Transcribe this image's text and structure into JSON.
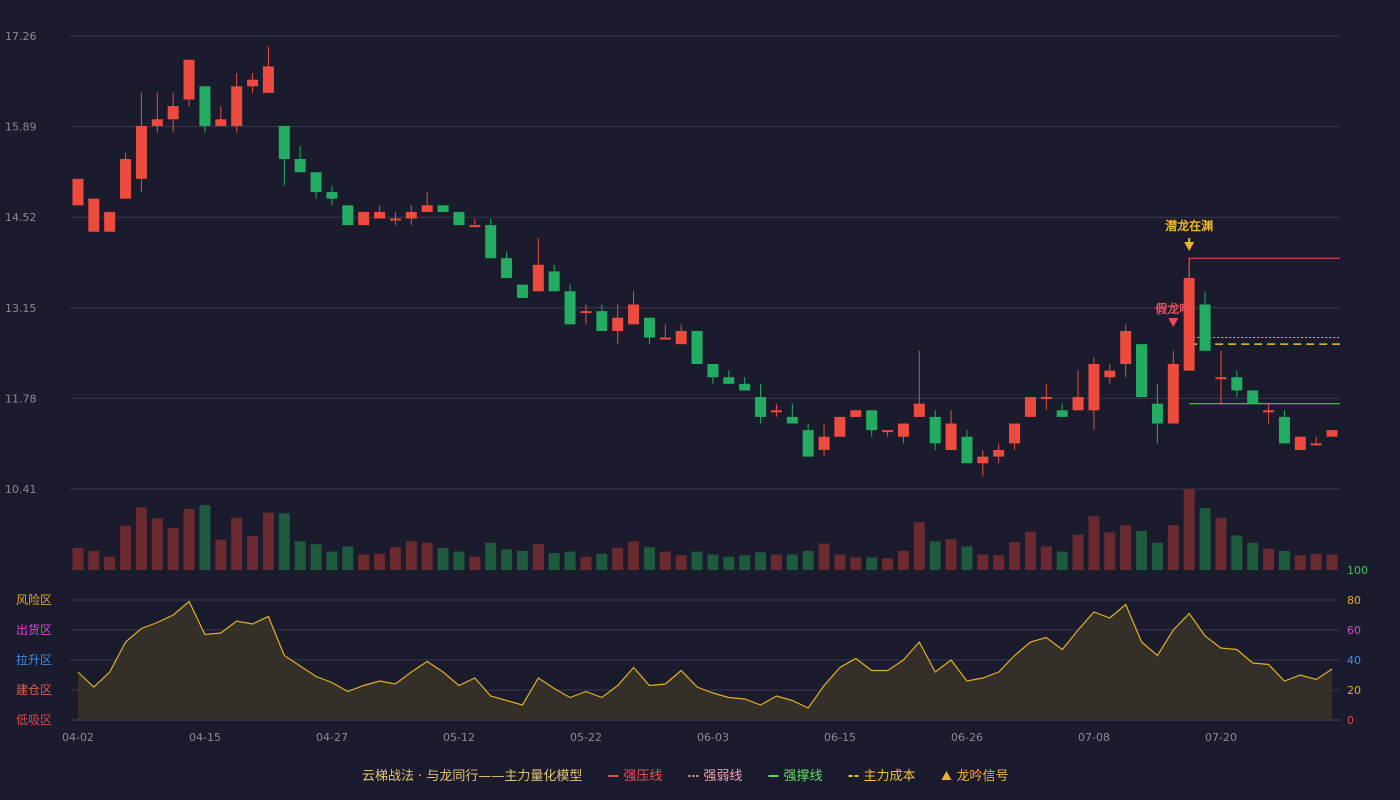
{
  "chart_data": {
    "type": "candlestick",
    "price_axis": {
      "ticks": [
        "17.26",
        "15.89",
        "14.52",
        "13.15",
        "11.78",
        "10.41"
      ],
      "ylim": [
        10.41,
        17.26
      ]
    },
    "date_ticks": [
      "04-02",
      "04-15",
      "04-27",
      "05-12",
      "05-22",
      "06-03",
      "06-15",
      "06-26",
      "07-08",
      "07-20"
    ],
    "candles": [
      [
        14.7,
        15.1,
        15.1,
        14.7
      ],
      [
        14.3,
        14.8,
        14.8,
        14.3
      ],
      [
        14.3,
        14.6,
        14.6,
        14.3
      ],
      [
        14.8,
        15.4,
        15.5,
        14.8
      ],
      [
        15.1,
        15.9,
        16.4,
        14.9
      ],
      [
        15.9,
        16.0,
        16.4,
        15.8
      ],
      [
        16.0,
        16.2,
        16.4,
        15.8
      ],
      [
        16.3,
        16.9,
        16.9,
        16.2
      ],
      [
        16.5,
        15.9,
        16.5,
        15.8
      ],
      [
        15.9,
        16.0,
        16.2,
        15.9
      ],
      [
        15.9,
        16.5,
        16.7,
        15.8
      ],
      [
        16.5,
        16.6,
        16.7,
        16.4
      ],
      [
        16.4,
        16.8,
        17.1,
        16.4
      ],
      [
        15.9,
        15.4,
        15.9,
        15.0
      ],
      [
        15.4,
        15.2,
        15.6,
        15.2
      ],
      [
        15.2,
        14.9,
        15.2,
        14.8
      ],
      [
        14.9,
        14.8,
        15.0,
        14.7
      ],
      [
        14.7,
        14.4,
        14.7,
        14.4
      ],
      [
        14.4,
        14.6,
        14.6,
        14.4
      ],
      [
        14.5,
        14.6,
        14.7,
        14.5
      ],
      [
        14.5,
        14.5,
        14.6,
        14.4
      ],
      [
        14.5,
        14.6,
        14.7,
        14.4
      ],
      [
        14.6,
        14.7,
        14.9,
        14.6
      ],
      [
        14.7,
        14.6,
        14.7,
        14.6
      ],
      [
        14.6,
        14.4,
        14.6,
        14.4
      ],
      [
        14.4,
        14.4,
        14.5,
        14.4
      ],
      [
        14.4,
        13.9,
        14.5,
        13.9
      ],
      [
        13.9,
        13.6,
        14.0,
        13.6
      ],
      [
        13.5,
        13.3,
        13.5,
        13.3
      ],
      [
        13.4,
        13.8,
        14.2,
        13.4
      ],
      [
        13.7,
        13.4,
        13.8,
        13.4
      ],
      [
        13.4,
        12.9,
        13.5,
        12.9
      ],
      [
        13.1,
        13.1,
        13.2,
        12.9
      ],
      [
        13.1,
        12.8,
        13.2,
        12.8
      ],
      [
        12.8,
        13.0,
        13.2,
        12.6
      ],
      [
        12.9,
        13.2,
        13.4,
        12.9
      ],
      [
        13.0,
        12.7,
        13.0,
        12.6
      ],
      [
        12.7,
        12.7,
        12.9,
        12.7
      ],
      [
        12.6,
        12.8,
        12.9,
        12.6
      ],
      [
        12.8,
        12.3,
        12.8,
        12.3
      ],
      [
        12.3,
        12.1,
        12.3,
        12.0
      ],
      [
        12.1,
        12.0,
        12.2,
        12.0
      ],
      [
        12.0,
        11.9,
        12.1,
        11.9
      ],
      [
        11.8,
        11.5,
        12.0,
        11.4
      ],
      [
        11.6,
        11.6,
        11.7,
        11.5
      ],
      [
        11.5,
        11.4,
        11.7,
        11.4
      ],
      [
        11.3,
        10.9,
        11.4,
        10.9
      ],
      [
        11.0,
        11.2,
        11.4,
        10.9
      ],
      [
        11.2,
        11.5,
        11.5,
        11.2
      ],
      [
        11.5,
        11.6,
        11.6,
        11.5
      ],
      [
        11.6,
        11.3,
        11.6,
        11.2
      ],
      [
        11.3,
        11.3,
        11.3,
        11.2
      ],
      [
        11.2,
        11.4,
        11.4,
        11.1
      ],
      [
        11.5,
        11.7,
        12.5,
        11.5
      ],
      [
        11.5,
        11.1,
        11.6,
        11.0
      ],
      [
        11.0,
        11.4,
        11.6,
        11.0
      ],
      [
        11.2,
        10.8,
        11.3,
        10.8
      ],
      [
        10.8,
        10.9,
        11.0,
        10.6
      ],
      [
        10.9,
        11.0,
        11.1,
        10.8
      ],
      [
        11.1,
        11.4,
        11.4,
        11.0
      ],
      [
        11.5,
        11.8,
        11.8,
        11.5
      ],
      [
        11.8,
        11.8,
        12.0,
        11.6
      ],
      [
        11.6,
        11.5,
        11.7,
        11.5
      ],
      [
        11.6,
        11.8,
        12.2,
        11.6
      ],
      [
        11.6,
        12.3,
        12.4,
        11.3
      ],
      [
        12.1,
        12.2,
        12.3,
        12.0
      ],
      [
        12.3,
        12.8,
        12.9,
        12.1
      ],
      [
        12.6,
        11.8,
        12.6,
        11.8
      ],
      [
        11.7,
        11.4,
        12.0,
        11.1
      ],
      [
        11.4,
        12.3,
        12.5,
        11.4
      ],
      [
        12.2,
        13.6,
        13.9,
        12.2
      ],
      [
        13.2,
        12.5,
        13.4,
        12.5
      ],
      [
        12.1,
        12.1,
        12.5,
        11.7
      ],
      [
        12.1,
        11.9,
        12.2,
        11.8
      ],
      [
        11.9,
        11.7,
        11.9,
        11.7
      ],
      [
        11.6,
        11.6,
        11.7,
        11.4
      ],
      [
        11.5,
        11.1,
        11.6,
        11.1
      ],
      [
        11.0,
        11.2,
        11.2,
        11.0
      ],
      [
        11.1,
        11.1,
        11.2,
        11.1
      ],
      [
        11.2,
        11.3,
        11.3,
        11.2
      ]
    ],
    "volume": [
      3,
      2.6,
      1.8,
      6,
      8.5,
      7,
      5.7,
      8.3,
      8.8,
      4.1,
      7.1,
      4.6,
      7.8,
      7.7,
      3.9,
      3.5,
      2.5,
      3.2,
      2.1,
      2.2,
      3.1,
      3.9,
      3.7,
      3.0,
      2.5,
      1.8,
      3.7,
      2.8,
      2.6,
      3.5,
      2.3,
      2.5,
      1.8,
      2.2,
      3.0,
      3.9,
      3.1,
      2.5,
      2.0,
      2.5,
      2.1,
      1.8,
      2.0,
      2.4,
      2.1,
      2.1,
      2.6,
      3.6,
      2.1,
      1.7,
      1.7,
      1.6,
      2.6,
      6.5,
      3.9,
      4.2,
      3.2,
      2.1,
      2.0,
      3.8,
      5.2,
      3.2,
      2.5,
      4.8,
      7.3,
      5.1,
      6.1,
      5.3,
      3.7,
      6.1,
      11,
      8.4,
      7.1,
      4.7,
      3.7,
      2.9,
      2.6,
      2.0,
      2.2,
      2.1
    ],
    "indicator": {
      "values": [
        32,
        22,
        32,
        52,
        61,
        65,
        70,
        79,
        57,
        58,
        66,
        64,
        69,
        43,
        36,
        29,
        25,
        19,
        23,
        26,
        24,
        32,
        39,
        32,
        23,
        28,
        16,
        13,
        10,
        28,
        21,
        15,
        19,
        15,
        23,
        35,
        23,
        24,
        33,
        22,
        18,
        15,
        14,
        10,
        16,
        13,
        8,
        23,
        35,
        41,
        33,
        33,
        40,
        52,
        32,
        40,
        26,
        28,
        32,
        43,
        52,
        55,
        47,
        60,
        72,
        68,
        77,
        52,
        43,
        60,
        71,
        56,
        48,
        47,
        38,
        37,
        26,
        30,
        27,
        34
      ],
      "ticks": [
        "100",
        "80",
        "60",
        "40",
        "20",
        "0"
      ],
      "tick_colors": [
        "#3ec55a",
        "#e5a52a",
        "#d04ad0",
        "#3a8ee6",
        "#e5a52a",
        "#e0464a"
      ],
      "zones": [
        {
          "label": "风险区",
          "color": "#e5a52a"
        },
        {
          "label": "出货区",
          "color": "#e040e0"
        },
        {
          "label": "拉升区",
          "color": "#3a8ee6"
        },
        {
          "label": "建仓区",
          "color": "#e25b50"
        },
        {
          "label": "低吸区",
          "color": "#e0464a"
        }
      ]
    },
    "annotations": {
      "qianlong": {
        "text": "潜龙在渊",
        "color": "#f0b429"
      },
      "jialong": {
        "text": "假龙吟",
        "color": "#e84c5a"
      }
    },
    "levels": {
      "strong_resist": 13.9,
      "weak_resist": 12.7,
      "main_cost": 12.6,
      "strong_support": 11.7
    },
    "legend": [
      {
        "label": "云梯战法 · 与龙同行——主力量化模型",
        "color": "#e5c07b",
        "symbol": ""
      },
      {
        "label": "强压线",
        "color": "#f05050",
        "symbol": "solid"
      },
      {
        "label": "强弱线",
        "color": "#f59fb0",
        "symbol": "dotted"
      },
      {
        "label": "强撑线",
        "color": "#5fe05f",
        "symbol": "solid"
      },
      {
        "label": "主力成本",
        "color": "#f0c030",
        "symbol": "dashed"
      },
      {
        "label": "龙吟信号",
        "color": "#f0b429",
        "symbol": "triangle"
      }
    ],
    "colors": {
      "up": "#ee4b3f",
      "down": "#22ad62",
      "up_vol": "#6a2a30",
      "down_vol": "#1e5a3e",
      "grid": "#3a3a4e",
      "indicator_line": "#e0b020",
      "indicator_fill": "#3a3328"
    }
  }
}
